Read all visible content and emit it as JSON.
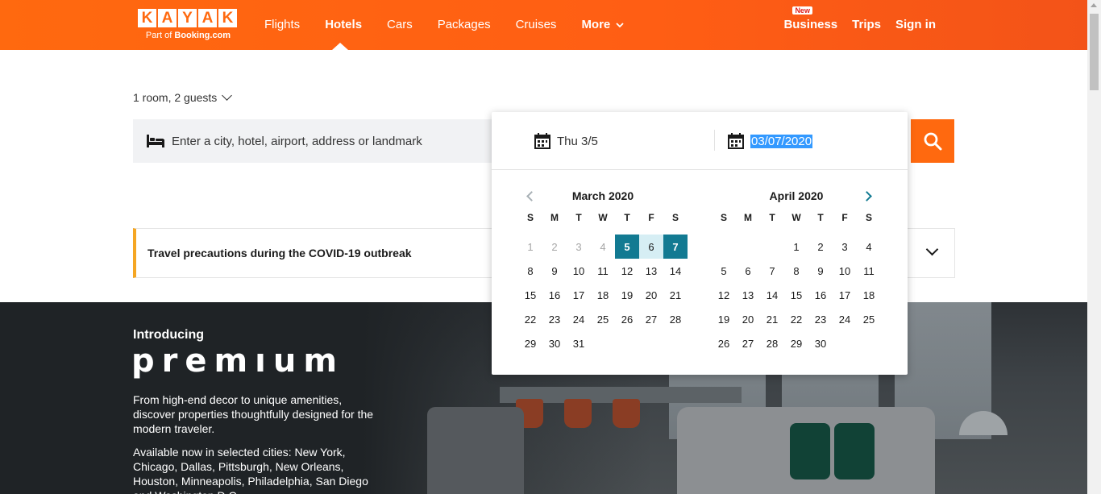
{
  "brand": {
    "letters": [
      "K",
      "A",
      "Y",
      "A",
      "K"
    ],
    "sub_prefix": "Part of ",
    "sub_brand": "Booking.com"
  },
  "nav": {
    "items": [
      {
        "label": "Flights"
      },
      {
        "label": "Hotels",
        "active": true
      },
      {
        "label": "Cars"
      },
      {
        "label": "Packages"
      },
      {
        "label": "Cruises"
      },
      {
        "label": "More"
      }
    ]
  },
  "right_nav": {
    "business_badge": "New",
    "business": "Business",
    "trips": "Trips",
    "sign_in": "Sign in"
  },
  "search": {
    "guests": "1 room, 2 guests",
    "destination_placeholder": "Enter a city, hotel, airport, address or landmark"
  },
  "notice": {
    "text": "Travel precautions during the COVID-19 outbreak"
  },
  "premium": {
    "intro": "Introducing",
    "logo": "premıum",
    "description": "From high-end decor to unique amenities, discover properties thoughtfully designed for the modern traveler.",
    "cities": "Available now in selected cities: New York, Chicago, Dallas, Pittsburgh, New Orleans, Houston, Minneapolis, Philadelphia, San Diego and Washington D.C."
  },
  "datepicker": {
    "start_value": "Thu 3/5",
    "end_value": "03/07/2020",
    "weekdays": [
      "S",
      "M",
      "T",
      "W",
      "T",
      "F",
      "S"
    ],
    "months": [
      {
        "title": "March 2020",
        "offset": 0,
        "days": 31,
        "past_until": 4,
        "selected_start": 5,
        "selected_end": 7
      },
      {
        "title": "April 2020",
        "offset": 3,
        "days": 30,
        "past_until": 0,
        "selected_start": null,
        "selected_end": null
      }
    ]
  },
  "colors": {
    "brand_orange": "#ff690f",
    "selected_teal": "#127a92",
    "range_light": "#d6eef4",
    "notice_accent": "#f5a623"
  }
}
